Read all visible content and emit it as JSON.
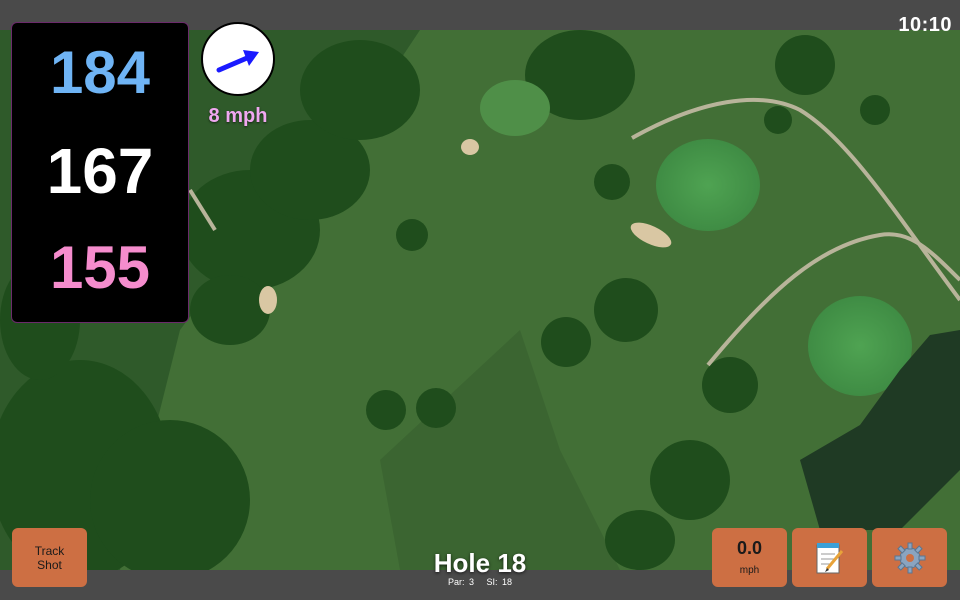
{
  "status": {
    "clock": "10:10"
  },
  "distances": {
    "back": "184",
    "middle": "167",
    "front": "155",
    "back_color": "#6fb4f5",
    "middle_color": "#ffffff",
    "front_color": "#f58ccd"
  },
  "wind": {
    "speed_label": "8 mph",
    "direction_icon": "arrow-icon",
    "arrow_color": "#1a1aff"
  },
  "buttons": {
    "track_shot_line1": "Track",
    "track_shot_line2": "Shot",
    "speed_value": "0.0",
    "speed_unit": "mph",
    "notes_icon": "notepad-icon",
    "settings_icon": "gear-icon",
    "button_color": "#cd6f43"
  },
  "hole": {
    "title": "Hole 18",
    "par": "Par: 3",
    "si": "SI: 18"
  }
}
